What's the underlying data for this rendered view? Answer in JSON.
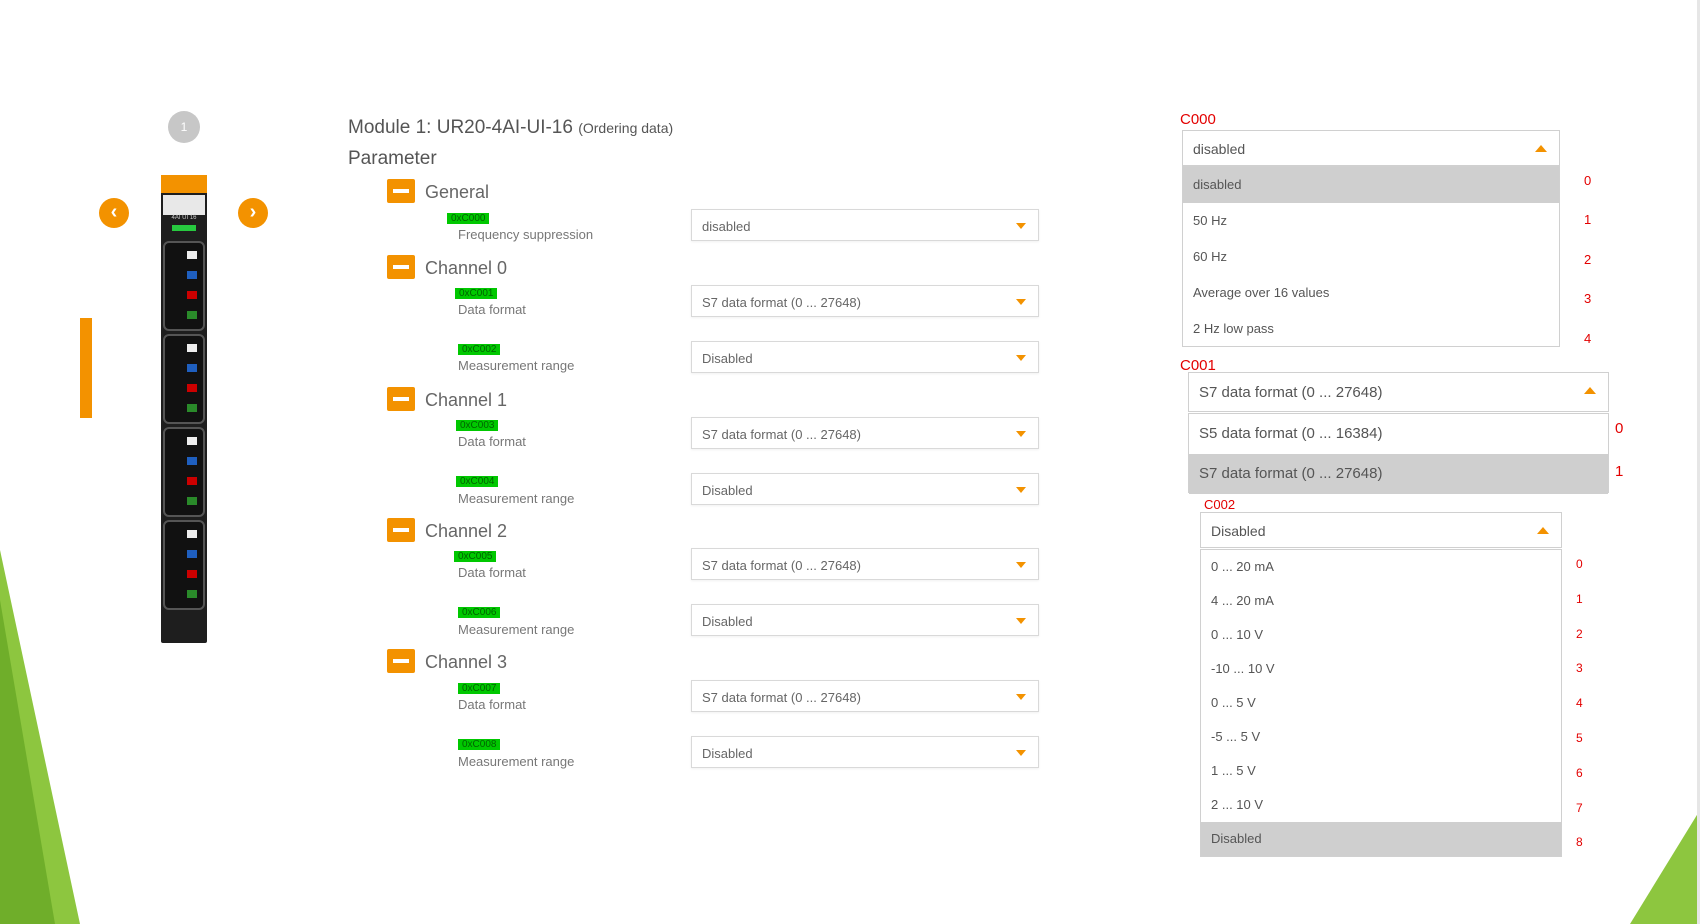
{
  "module": {
    "step": "1",
    "title": "Module 1: UR20-4AI-UI-16",
    "ordering": "(Ordering data)",
    "parameter_heading": "Parameter",
    "device_text": "4AI UI 16"
  },
  "sections": [
    {
      "label": "General",
      "params": [
        {
          "code": "0xC000",
          "label": "Frequency suppression",
          "value": "disabled"
        }
      ]
    },
    {
      "label": "Channel 0",
      "params": [
        {
          "code": "0xC001",
          "label": "Data format",
          "value": "S7 data format (0 ... 27648)"
        },
        {
          "code": "0xC002",
          "label": "Measurement range",
          "value": "Disabled"
        }
      ]
    },
    {
      "label": "Channel 1",
      "params": [
        {
          "code": "0xC003",
          "label": "Data format",
          "value": "S7 data format (0 ... 27648)"
        },
        {
          "code": "0xC004",
          "label": "Measurement range",
          "value": "Disabled"
        }
      ]
    },
    {
      "label": "Channel 2",
      "params": [
        {
          "code": "0xC005",
          "label": "Data format",
          "value": "S7 data format (0 ... 27648)"
        },
        {
          "code": "0xC006",
          "label": "Measurement range",
          "value": "Disabled"
        }
      ]
    },
    {
      "label": "Channel 3",
      "params": [
        {
          "code": "0xC007",
          "label": "Data format",
          "value": "S7 data format (0 ... 27648)"
        },
        {
          "code": "0xC008",
          "label": "Measurement range",
          "value": "Disabled"
        }
      ]
    }
  ],
  "dropdowns": {
    "c000": {
      "label": "C000",
      "selected": "disabled",
      "options": [
        "disabled",
        "50 Hz",
        "60 Hz",
        "Average over 16 values",
        "2 Hz low pass"
      ],
      "indices": [
        "0",
        "1",
        "2",
        "3",
        "4"
      ],
      "selected_index": 0
    },
    "c001": {
      "label": "C001",
      "selected": "S7 data format (0 ... 27648)",
      "options": [
        "S5 data format (0 ... 16384)",
        "S7 data format (0 ... 27648)"
      ],
      "indices": [
        "0",
        "1"
      ],
      "selected_index": 1
    },
    "c002": {
      "label": "C002",
      "selected": "Disabled",
      "options": [
        "0 ... 20 mA",
        "4 ... 20 mA",
        "0 ... 10 V",
        "-10 ... 10 V",
        "0 ... 5 V",
        "-5 ... 5 V",
        "1 ... 5 V",
        "2 ... 10 V",
        "Disabled"
      ],
      "indices": [
        "0",
        "1",
        "2",
        "3",
        "4",
        "5",
        "6",
        "7",
        "8"
      ],
      "selected_index": 8
    }
  },
  "colors": {
    "accent": "#f39200",
    "code_bg": "#00c800",
    "annotation": "#e30000",
    "slide_green": "#8dc63f"
  },
  "icons": {
    "prev": "chevron-left-icon",
    "next": "chevron-right-icon",
    "toggle": "minus-icon",
    "caret": "caret-down-icon"
  }
}
